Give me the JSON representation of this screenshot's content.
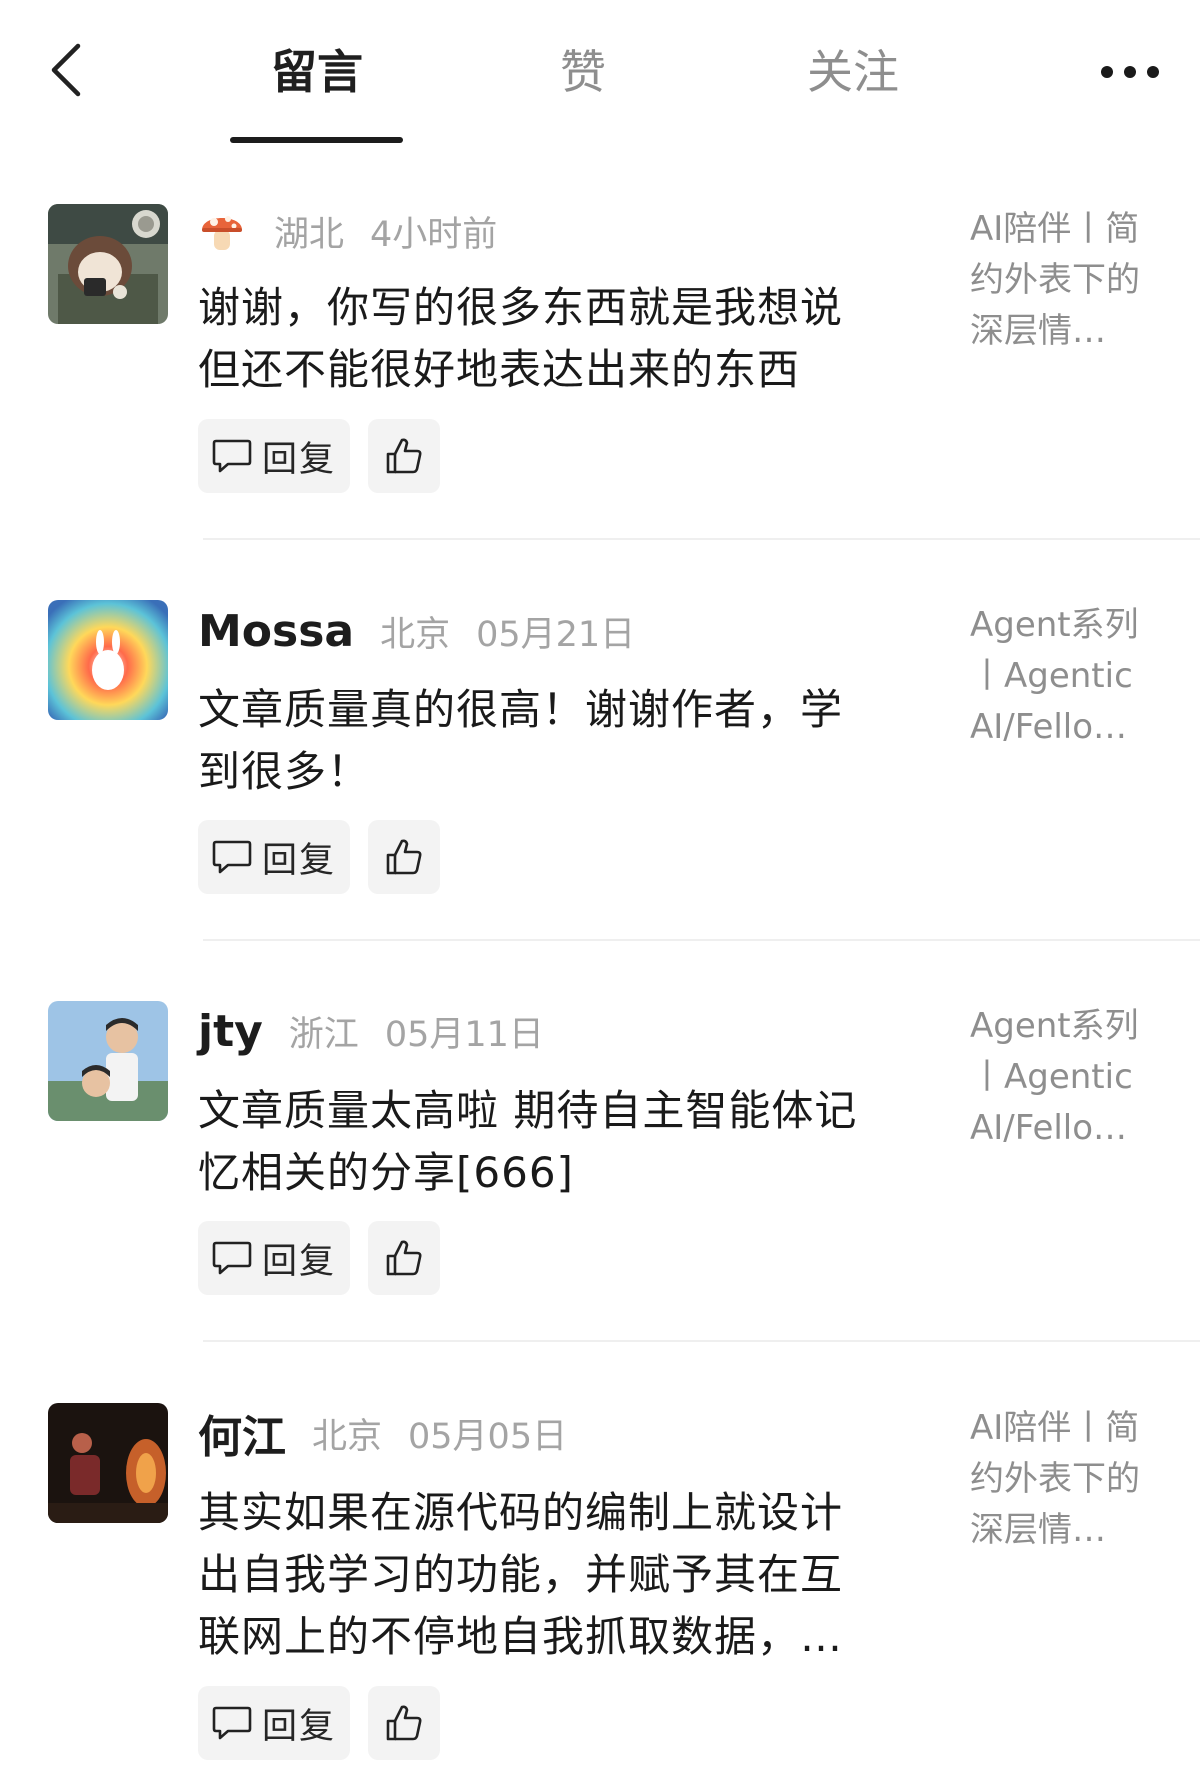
{
  "header": {
    "back_icon": "chevron-left-icon",
    "tabs": [
      {
        "label": "留言",
        "active": true
      },
      {
        "label": "赞",
        "active": false
      },
      {
        "label": "关注",
        "active": false
      }
    ],
    "more_icon": "more-dots-icon"
  },
  "comments": [
    {
      "username": "",
      "username_icon": "mushroom-icon",
      "location": "湖北",
      "time": "4小时前",
      "text": "谢谢，你写的很多东西就是我想说\n但还不能很好地表达出来的东西",
      "article": "AI陪伴丨简\n约外表下的\n深层情…",
      "reply_label": "回复"
    },
    {
      "username": "Mossa",
      "location": "北京",
      "time": "05月21日",
      "text": "文章质量真的很高！谢谢作者，学\n到很多！",
      "article": "Agent系列\n丨Agentic\nAI/Fello…",
      "reply_label": "回复"
    },
    {
      "username": "jty",
      "location": "浙江",
      "time": "05月11日",
      "text": "文章质量太高啦 期待自主智能体记\n忆相关的分享[666]",
      "article": "Agent系列\n丨Agentic\nAI/Fello…",
      "reply_label": "回复"
    },
    {
      "username": "何江",
      "location": "北京",
      "time": "05月05日",
      "text": "其实如果在源代码的编制上就设计\n出自我学习的功能，并赋予其在互\n联网上的不停地自我抓取数据，…",
      "article": "AI陪伴丨简\n约外表下的\n深层情…",
      "reply_label": "回复"
    }
  ],
  "colors": {
    "text_primary": "#1a1a1a",
    "text_secondary": "#8e8e8e",
    "meta_gray": "#a4a4a4",
    "button_bg": "#f3f3f3",
    "divider": "#efefef",
    "active_tab_underline": "#1c1c1c"
  }
}
